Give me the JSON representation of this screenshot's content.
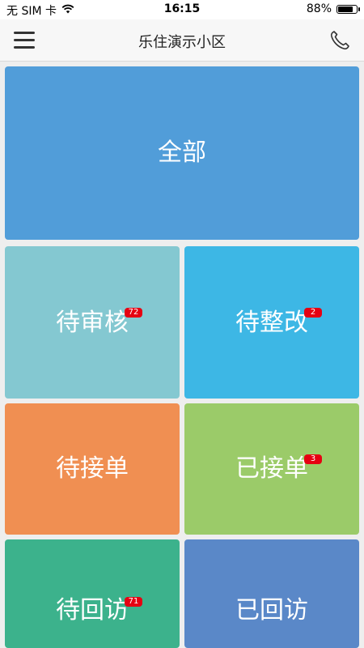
{
  "status_bar": {
    "carrier": "无 SIM 卡",
    "wifi_icon": "wifi-icon",
    "time": "16:15",
    "battery_text": "88%",
    "battery_level": 0.88
  },
  "nav": {
    "title": "乐住演示小区",
    "menu_icon": "hamburger-menu-icon",
    "phone_icon": "phone-icon"
  },
  "tiles": [
    {
      "label": "全部",
      "badge": "",
      "color": "#519dd9"
    },
    {
      "label": "待审核",
      "badge": "72",
      "color": "#84c8d1"
    },
    {
      "label": "待整改",
      "badge": "2",
      "color": "#3db7e5"
    },
    {
      "label": "待接单",
      "badge": "",
      "color": "#f08f52"
    },
    {
      "label": "已接单",
      "badge": "3",
      "color": "#9bcb69"
    },
    {
      "label": "待回访",
      "badge": "71",
      "color": "#3cb28c"
    },
    {
      "label": "已回访",
      "badge": "",
      "color": "#5a88c8"
    }
  ],
  "badge_color": "#e60012"
}
